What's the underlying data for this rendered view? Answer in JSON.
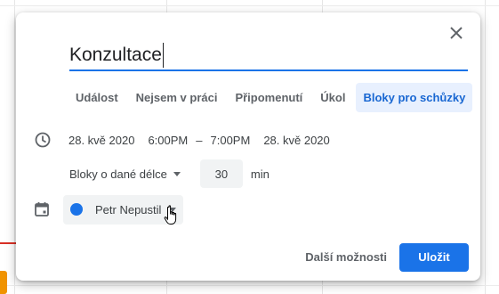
{
  "dialog": {
    "title": "Konzultace",
    "tabs": [
      {
        "label": "Událost"
      },
      {
        "label": "Nejsem v práci"
      },
      {
        "label": "Připomenutí"
      },
      {
        "label": "Úkol"
      },
      {
        "label": "Bloky pro schůzky"
      }
    ],
    "active_tab": "Bloky pro schůzky",
    "time": {
      "start_date": "28. kvě 2020",
      "start_time": "6:00PM",
      "separator": "–",
      "end_time": "7:00PM",
      "end_date": "28. kvě 2020"
    },
    "duration": {
      "mode_label": "Bloky o dané délce",
      "value": "30",
      "unit": "min"
    },
    "calendar": {
      "name": "Petr Nepustil",
      "color": "#1a73e8"
    },
    "footer": {
      "more_label": "Další možnosti",
      "save_label": "Uložit"
    }
  },
  "colors": {
    "accent": "#1a73e8",
    "active_tab_bg": "#e8f0fe"
  },
  "icons": [
    "close-icon",
    "clock-icon",
    "calendar-icon",
    "caret-down-icon",
    "hand-pointer-cursor"
  ]
}
